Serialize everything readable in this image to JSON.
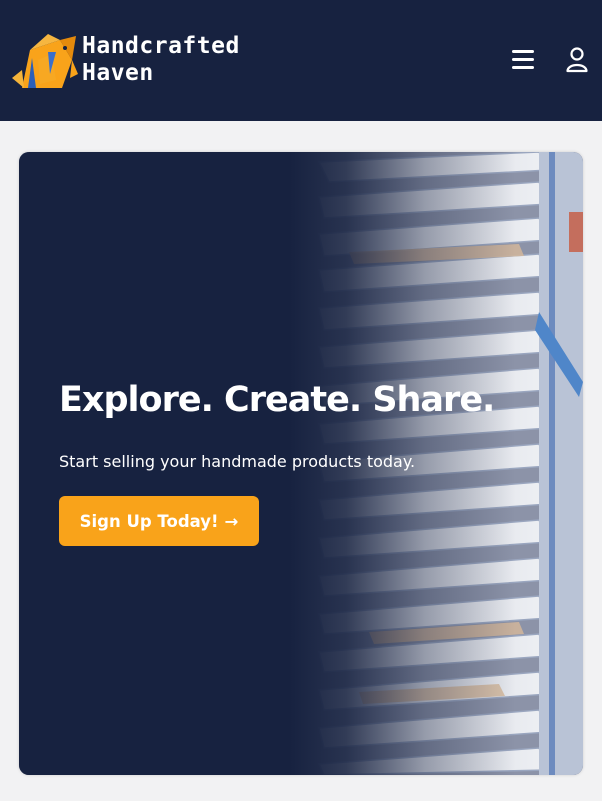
{
  "header": {
    "brand_line1": "Handcrafted",
    "brand_line2": "Haven",
    "logo_icon": "origami-elephant-icon",
    "menu_icon": "hamburger-menu-icon",
    "user_icon": "user-account-icon",
    "background": "#172240"
  },
  "hero": {
    "title": "Explore. Create. Share.",
    "subtitle": "Start selling your handmade products today.",
    "cta_label": "Sign Up Today!",
    "cta_arrow": "→",
    "cta_color": "#f9a31a",
    "background": "#172240"
  }
}
